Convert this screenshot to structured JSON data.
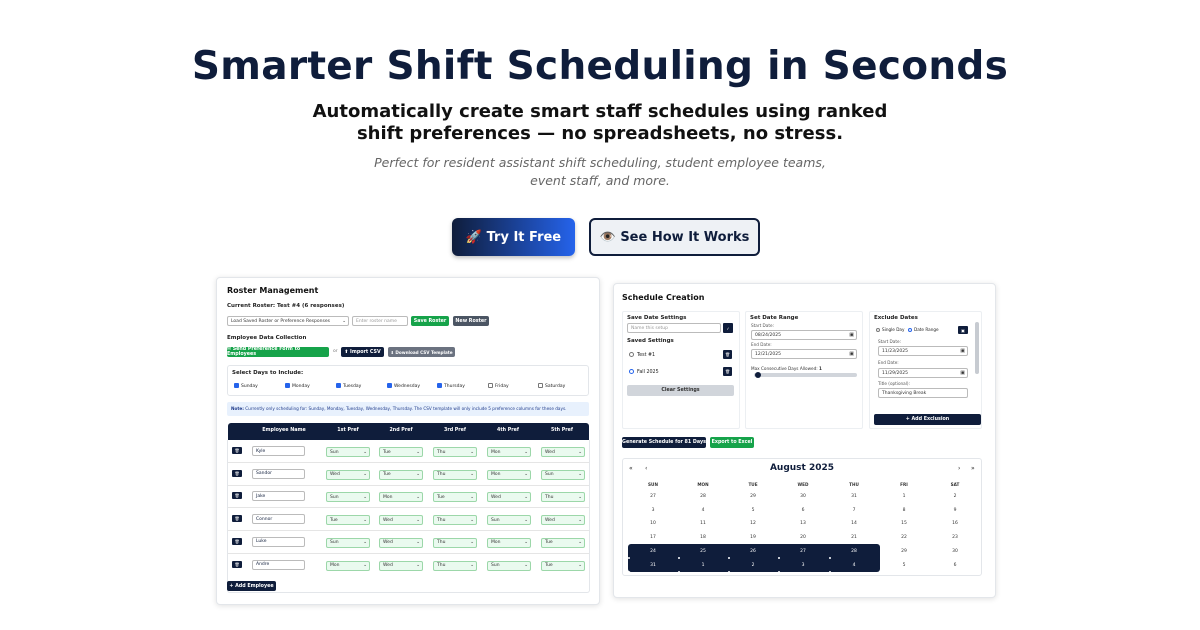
{
  "hero": {
    "title": "Smarter Shift Scheduling in Seconds",
    "subtitle_line1": "Automatically create smart staff schedules using ranked",
    "subtitle_line2": "shift preferences — no spreadsheets, no stress.",
    "tagline_line1": "Perfect for resident assistant shift scheduling, student employee teams,",
    "tagline_line2": "event staff, and more.",
    "cta_primary": "🚀 Try It Free",
    "cta_secondary": "👁️ See How It Works"
  },
  "roster": {
    "title": "Roster Management",
    "current": "Current Roster: Test #4 (6 responses)",
    "load_select": "Load Saved Roster or Preference Responses",
    "name_placeholder": "Enter roster name",
    "save_btn": "Save Roster",
    "new_btn": "New Roster",
    "collection_title": "Employee Data Collection",
    "send_btn": "✉ Send Preference Form to Employees",
    "or": "or",
    "import_btn": "⬆ Import CSV",
    "download_btn": "⬇ Download CSV Template",
    "days_title": "Select Days to Include:",
    "days": [
      {
        "label": "Sunday",
        "checked": true
      },
      {
        "label": "Monday",
        "checked": true
      },
      {
        "label": "Tuesday",
        "checked": true
      },
      {
        "label": "Wednesday",
        "checked": true
      },
      {
        "label": "Thursday",
        "checked": true
      },
      {
        "label": "Friday",
        "checked": false
      },
      {
        "label": "Saturday",
        "checked": false
      }
    ],
    "note_bold": "Note:",
    "note_text": "Currently only scheduling for: Sunday, Monday, Tuesday, Wednesday, Thursday. The CSV template will only include 5 preference columns for these days.",
    "columns": [
      "Employee Name",
      "1st Pref",
      "2nd Pref",
      "3rd Pref",
      "4th Pref",
      "5th Pref"
    ],
    "employees": [
      {
        "name": "Kyle",
        "prefs": [
          "Sun",
          "Tue",
          "Thu",
          "Mon",
          "Wed"
        ]
      },
      {
        "name": "Sandor",
        "prefs": [
          "Wed",
          "Tue",
          "Thu",
          "Mon",
          "Sun"
        ]
      },
      {
        "name": "Jake",
        "prefs": [
          "Sun",
          "Mon",
          "Tue",
          "Wed",
          "Thu"
        ]
      },
      {
        "name": "Connor",
        "prefs": [
          "Tue",
          "Wed",
          "Thu",
          "Sun",
          "Wed"
        ]
      },
      {
        "name": "Luke",
        "prefs": [
          "Sun",
          "Wed",
          "Thu",
          "Mon",
          "Tue"
        ]
      },
      {
        "name": "Andre",
        "prefs": [
          "Mon",
          "Wed",
          "Thu",
          "Sun",
          "Tue"
        ]
      }
    ],
    "add_btn": "+ Add Employee"
  },
  "schedule": {
    "title": "Schedule Creation",
    "save_title": "Save Date Settings",
    "save_placeholder": "Name this setup",
    "saved_title": "Saved Settings",
    "saved": [
      "Test #1",
      "Fall 2025"
    ],
    "clear_btn": "Clear Settings",
    "range_title": "Set Date Range",
    "start_label": "Start Date:",
    "start_val": "08/24/2025",
    "end_label": "End Date:",
    "end_val": "12/21/2025",
    "max_label": "Max Consecutive Days Allowed:",
    "max_val": "1",
    "max_fraction": 0.0,
    "exclude_title": "Exclude Dates",
    "single_day": "Single Day",
    "date_range": "Date Range",
    "ex_start_label": "Start Date:",
    "ex_start_val": "11/23/2025",
    "ex_end_label": "End Date:",
    "ex_end_val": "11/29/2025",
    "ex_title_label": "Title (optional):",
    "ex_title_val": "Thanksgiving Break",
    "add_ex_btn": "+ Add Exclusion",
    "generate_btn": "Generate Schedule for 81 Days",
    "export_btn": "Export to Excel",
    "month": "August 2025",
    "nav_first": "«",
    "nav_prev": "‹",
    "nav_next": "›",
    "nav_last": "»",
    "weekdays": [
      "SUN",
      "MON",
      "TUE",
      "WED",
      "THU",
      "FRI",
      "SAT"
    ],
    "weeks": [
      [
        "27",
        "28",
        "29",
        "30",
        "31",
        "1",
        "2"
      ],
      [
        "3",
        "4",
        "5",
        "6",
        "7",
        "8",
        "9"
      ],
      [
        "10",
        "11",
        "12",
        "13",
        "14",
        "15",
        "16"
      ],
      [
        "17",
        "18",
        "19",
        "20",
        "21",
        "22",
        "23"
      ],
      [
        "24",
        "25",
        "26",
        "27",
        "28",
        "29",
        "30"
      ],
      [
        "31",
        "1",
        "2",
        "3",
        "4",
        "5",
        "6"
      ]
    ]
  }
}
